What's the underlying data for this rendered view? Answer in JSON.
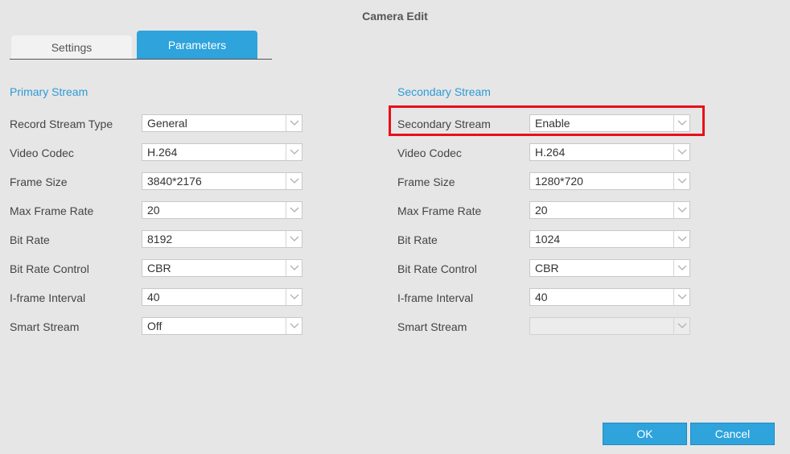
{
  "dialog": {
    "title": "Camera Edit"
  },
  "tabs": [
    {
      "label": "Settings",
      "active": false
    },
    {
      "label": "Parameters",
      "active": true
    }
  ],
  "primary": {
    "title": "Primary Stream",
    "fields": [
      {
        "label": "Record Stream Type",
        "value": "General"
      },
      {
        "label": "Video Codec",
        "value": "H.264"
      },
      {
        "label": "Frame Size",
        "value": "3840*2176"
      },
      {
        "label": "Max Frame Rate",
        "value": "20"
      },
      {
        "label": "Bit Rate",
        "value": "8192"
      },
      {
        "label": "Bit Rate Control",
        "value": "CBR"
      },
      {
        "label": "I-frame Interval",
        "value": "40"
      },
      {
        "label": "Smart Stream",
        "value": "Off"
      }
    ]
  },
  "secondary": {
    "title": "Secondary Stream",
    "fields": [
      {
        "label": "Secondary Stream",
        "value": "Enable"
      },
      {
        "label": "Video Codec",
        "value": "H.264"
      },
      {
        "label": "Frame Size",
        "value": "1280*720"
      },
      {
        "label": "Max Frame Rate",
        "value": "20"
      },
      {
        "label": "Bit Rate",
        "value": "1024"
      },
      {
        "label": "Bit Rate Control",
        "value": "CBR"
      },
      {
        "label": "I-frame Interval",
        "value": "40"
      },
      {
        "label": "Smart Stream",
        "value": ""
      }
    ]
  },
  "buttons": {
    "ok": "OK",
    "cancel": "Cancel"
  },
  "colors": {
    "accent": "#2ea3dc",
    "highlight": "#e8101a",
    "background": "#e6e6e6"
  },
  "icons": {
    "dropdown": "chevron-down-icon"
  }
}
